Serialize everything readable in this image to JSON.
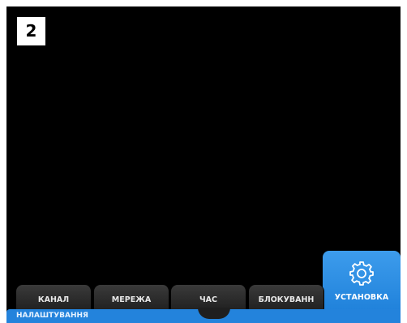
{
  "step_badge": "2",
  "tabs": [
    {
      "label": "КАНАЛ",
      "icon": ""
    },
    {
      "label": "МЕРЕЖА",
      "icon": ""
    },
    {
      "label": "ЧАС",
      "icon": ""
    },
    {
      "label": "БЛОКУВАНН",
      "icon": ""
    }
  ],
  "active_tab": {
    "label": "УСТАНОВКА",
    "icon": "gear-icon"
  },
  "bottom_bar": {
    "label": "НАЛАШТУВАННЯ"
  },
  "colors": {
    "background": "#000000",
    "accent": "#2383dc",
    "tab": "#2a2a2a"
  }
}
